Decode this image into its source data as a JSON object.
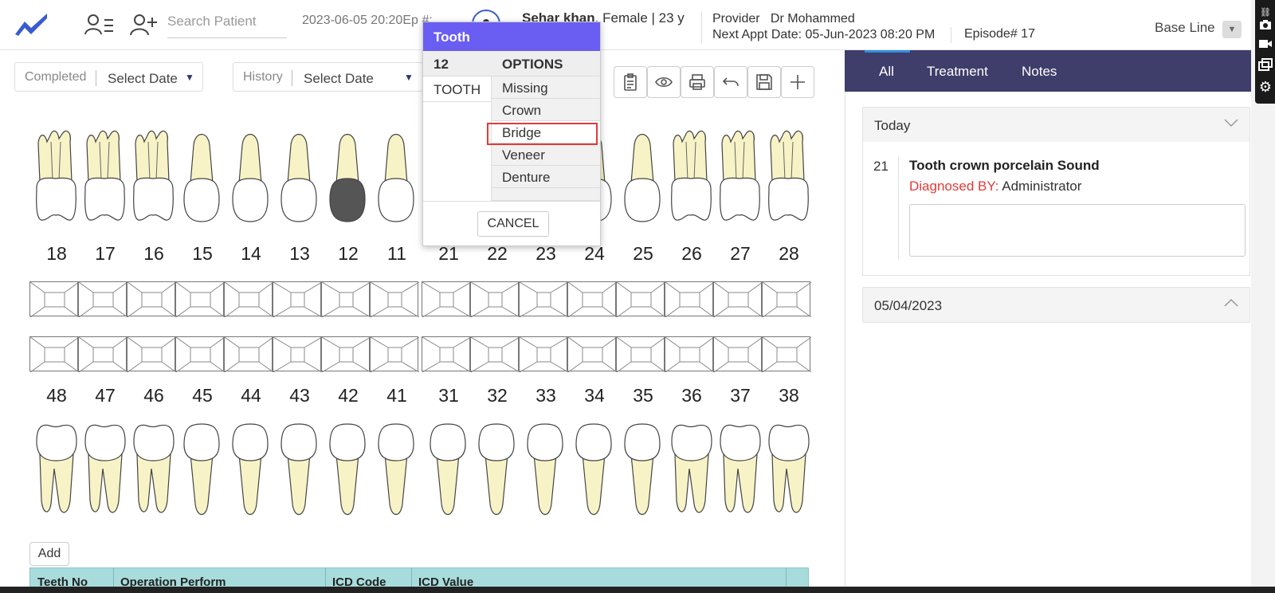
{
  "header": {
    "search_placeholder": "Search Patient",
    "datetime": "2023-06-05 20:20Ep #:",
    "patient_name": "Sehar khan",
    "patient_details": ", Female | 23 y",
    "provider_label": "Provider",
    "provider_name": "Dr Mohammed",
    "next_appt_label": "Next Appt Date:",
    "next_appt_value": "05-Jun-2023 08:20 PM",
    "episode": "Episode# 17",
    "baseline": "Base Line"
  },
  "filters": {
    "completed_label": "Completed",
    "completed_value": "Select Date",
    "history_label": "History",
    "history_value": "Select Date"
  },
  "chart": {
    "upper_teeth": [
      "18",
      "17",
      "16",
      "15",
      "14",
      "13",
      "12",
      "11",
      "21",
      "22",
      "23",
      "24",
      "25",
      "26",
      "27",
      "28"
    ],
    "lower_teeth": [
      "48",
      "47",
      "46",
      "45",
      "44",
      "43",
      "42",
      "41",
      "31",
      "32",
      "33",
      "34",
      "35",
      "36",
      "37",
      "38"
    ],
    "highlighted_tooth": "12"
  },
  "tabs": [
    "All",
    "Treatment",
    "Notes"
  ],
  "history": {
    "today_label": "Today",
    "entry_tooth": "21",
    "entry_title": "Tooth crown porcelain Sound",
    "diagnosed_label": "Diagnosed BY:",
    "diagnosed_value": "Administrator",
    "past_date": "05/04/2023"
  },
  "table": {
    "add_label": "Add",
    "headers": [
      "Teeth No",
      "Operation Perform",
      "ICD Code",
      "ICD Value"
    ]
  },
  "popup": {
    "title": "Tooth",
    "tooth_number": "12",
    "tooth_label": "TOOTH",
    "options_header": "OPTIONS",
    "options": [
      "Missing",
      "Crown",
      "Bridge",
      "Veneer",
      "Denture"
    ],
    "selected_option": "Bridge",
    "cancel_label": "CANCEL"
  },
  "colors": {
    "tabbar": "#3f3d6a",
    "popup_header": "#6a5ef2",
    "highlight": "#e53935",
    "tooth_root": "#f7f3c6"
  }
}
